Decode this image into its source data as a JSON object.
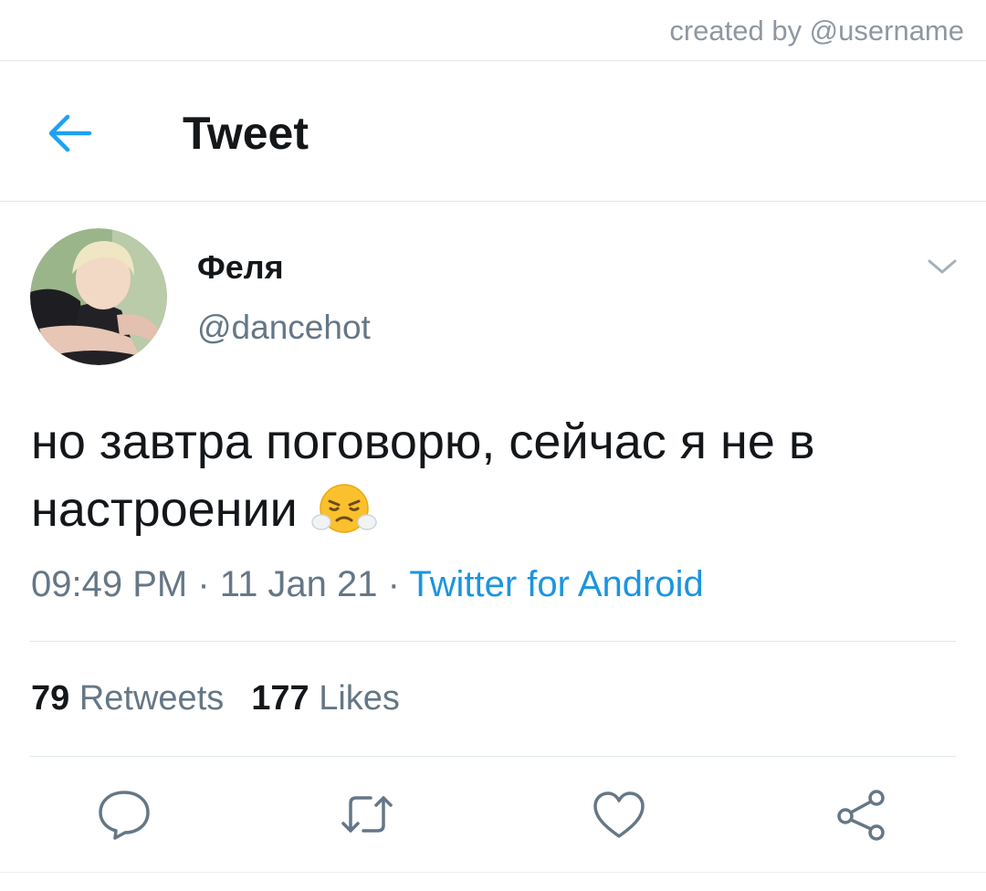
{
  "watermark": "created by @username",
  "header": {
    "title": "Tweet",
    "back_icon": "arrow-left-icon"
  },
  "author": {
    "display_name": "Феля",
    "handle": "@dancehot"
  },
  "tweet": {
    "text": "но завтра поговорю, сейчас я не в настроении",
    "emoji": "face-with-steam-from-nose",
    "time": "09:49 PM",
    "date": "11 Jan 21",
    "separator": "·",
    "source": "Twitter for Android"
  },
  "stats": {
    "retweets_count": "79",
    "retweets_label": "Retweets",
    "likes_count": "177",
    "likes_label": "Likes"
  },
  "actions": [
    "reply-icon",
    "retweet-icon",
    "like-icon",
    "share-icon"
  ],
  "colors": {
    "accent": "#1b95e0",
    "text": "#14171a",
    "secondary": "#657786",
    "divider": "#e1e8ed"
  }
}
